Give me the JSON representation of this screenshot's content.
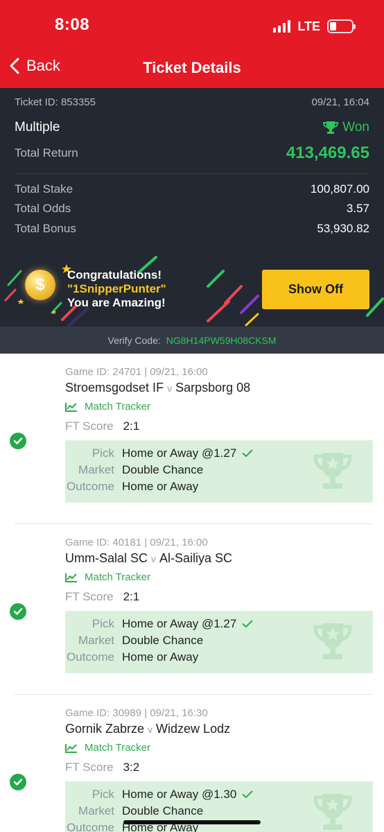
{
  "status_bar": {
    "time": "8:08",
    "network": "LTE"
  },
  "header": {
    "back_label": "Back",
    "title": "Ticket Details"
  },
  "ticket": {
    "id_text": "Ticket ID: 853355",
    "datetime": "09/21, 16:04",
    "type": "Multiple",
    "status": "Won",
    "total_return_label": "Total Return",
    "total_return": "413,469.65",
    "total_stake_label": "Total Stake",
    "total_stake": "100,807.00",
    "total_odds_label": "Total Odds",
    "total_odds": "3.57",
    "total_bonus_label": "Total Bonus",
    "total_bonus": "53,930.82"
  },
  "banner": {
    "line1": "Congratulations!",
    "line2": "\"1SnipperPunter\"",
    "line3": "You are Amazing!",
    "button": "Show Off"
  },
  "verify": {
    "label": "Verify Code:",
    "code": "NG8H14PW59H08CKSM"
  },
  "games": [
    {
      "meta": "Game ID: 24701 | 09/21, 16:00",
      "home": "Stroemsgodset IF",
      "vs": "v",
      "away": "Sarpsborg 08",
      "tracker": "Match Tracker",
      "score_label": "FT Score",
      "score": "2:1",
      "pick_label": "Pick",
      "pick": "Home or Away @1.27",
      "market_label": "Market",
      "market": "Double Chance",
      "outcome_label": "Outcome",
      "outcome": "Home or Away"
    },
    {
      "meta": "Game ID: 40181 | 09/21, 16:00",
      "home": "Umm-Salal SC",
      "vs": "v",
      "away": "Al-Sailiya SC",
      "tracker": "Match Tracker",
      "score_label": "FT Score",
      "score": "2:1",
      "pick_label": "Pick",
      "pick": "Home or Away @1.27",
      "market_label": "Market",
      "market": "Double Chance",
      "outcome_label": "Outcome",
      "outcome": "Home or Away"
    },
    {
      "meta": "Game ID: 30989 | 09/21, 16:30",
      "home": "Gornik Zabrze",
      "vs": "v",
      "away": "Widzew Lodz",
      "tracker": "Match Tracker",
      "score_label": "FT Score",
      "score": "3:2",
      "pick_label": "Pick",
      "pick": "Home or Away @1.30",
      "market_label": "Market",
      "market": "Double Chance",
      "outcome_label": "Outcome",
      "outcome": "Home or Away"
    }
  ],
  "colors": {
    "brand_red": "#e41a26",
    "win_green": "#2fc55d",
    "accent_yellow": "#f9c21a",
    "dark_bg": "#232832"
  }
}
